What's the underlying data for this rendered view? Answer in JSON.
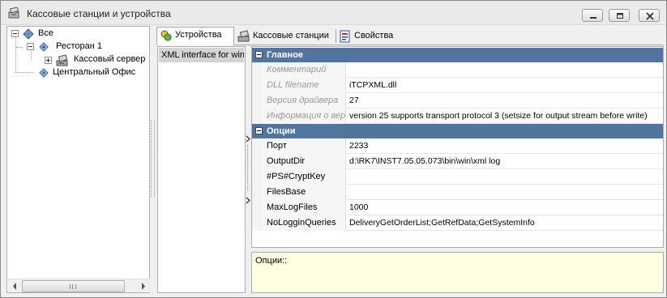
{
  "window": {
    "title": "Кассовые станции и устройства",
    "controls": [
      "minimize-icon",
      "maximize-icon",
      "close-icon"
    ]
  },
  "tree": {
    "items": [
      {
        "label": "Все",
        "level": 0,
        "expanded": true,
        "icon": "globe-icon"
      },
      {
        "label": "Ресторан 1",
        "level": 1,
        "expanded": true,
        "icon": "restaurant-icon"
      },
      {
        "label": "Кассовый сервер",
        "level": 2,
        "expanded": false,
        "icon": "server-icon"
      },
      {
        "label": "Центральный Офис",
        "level": 1,
        "expanded": null,
        "icon": "office-icon"
      }
    ],
    "scrollbar_grip": "III"
  },
  "tabs": [
    {
      "label": "Устройства",
      "active": true,
      "icon": "devices-icon"
    },
    {
      "label": "Кассовые станции",
      "active": false,
      "icon": "cash-station-icon"
    },
    {
      "label": "Свойства",
      "active": false,
      "icon": "properties-icon"
    }
  ],
  "devices": {
    "items": [
      {
        "label": "XML interface for win",
        "selected": true
      }
    ]
  },
  "property_grid": {
    "categories": [
      {
        "label": "Главное",
        "collapse_symbol": "−",
        "properties": [
          {
            "name": "Комментарий",
            "value": "",
            "readonly": true
          },
          {
            "name": "DLL filename",
            "value": "iTCPXML.dll",
            "readonly": true
          },
          {
            "name": "Версия драйвера",
            "value": "27",
            "readonly": true
          },
          {
            "name": "Информация о вер",
            "value": "version 25 supports transport protocol 3 (setsize for output stream before write)",
            "readonly": true
          }
        ]
      },
      {
        "label": "Опции",
        "collapse_symbol": "−",
        "properties": [
          {
            "name": "Порт",
            "value": "2233",
            "readonly": false
          },
          {
            "name": "OutputDir",
            "value": "d:\\RK7\\INST7.05.05.073\\bin\\win\\xml log",
            "readonly": false
          },
          {
            "name": "#PS#CryptKey",
            "value": "",
            "readonly": false
          },
          {
            "name": "FilesBase",
            "value": "",
            "readonly": false
          },
          {
            "name": "MaxLogFiles",
            "value": "1000",
            "readonly": false
          },
          {
            "name": "NoLogginQueries",
            "value": "DeliveryGetOrderList;GetRefData;GetSystemInfo",
            "readonly": false
          }
        ]
      }
    ]
  },
  "description": {
    "text": "Опции::"
  },
  "colors": {
    "category_header": "#5474a0",
    "description_bg": "#ffffe1",
    "selection": "#d4d4d4"
  }
}
